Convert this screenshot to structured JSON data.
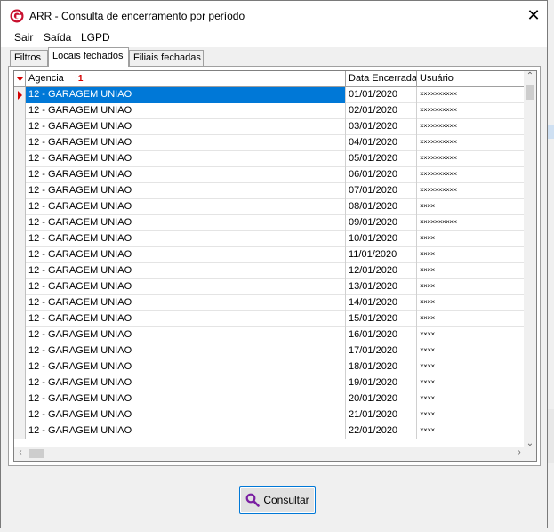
{
  "window": {
    "title": "ARR - Consulta de encerramento por período",
    "close_glyph": "✕"
  },
  "menu": {
    "items": [
      "Sair",
      "Saída",
      "LGPD"
    ]
  },
  "tabs": [
    {
      "label": "Filtros",
      "active": false
    },
    {
      "label": "Locais fechados",
      "active": true
    },
    {
      "label": "Filiais fechadas",
      "active": false
    }
  ],
  "grid": {
    "columns": [
      {
        "label": "Agencia",
        "sort": "1"
      },
      {
        "label": "Data Encerrada"
      },
      {
        "label": "Usuário"
      }
    ],
    "rows": [
      {
        "agencia": "12 - GARAGEM UNIAO",
        "data": "01/01/2020",
        "usuario": "××××××××××"
      },
      {
        "agencia": "12 - GARAGEM UNIAO",
        "data": "02/01/2020",
        "usuario": "××××××××××"
      },
      {
        "agencia": "12 - GARAGEM UNIAO",
        "data": "03/01/2020",
        "usuario": "××××××××××"
      },
      {
        "agencia": "12 - GARAGEM UNIAO",
        "data": "04/01/2020",
        "usuario": "××××××××××"
      },
      {
        "agencia": "12 - GARAGEM UNIAO",
        "data": "05/01/2020",
        "usuario": "××××××××××"
      },
      {
        "agencia": "12 - GARAGEM UNIAO",
        "data": "06/01/2020",
        "usuario": "××××××××××"
      },
      {
        "agencia": "12 - GARAGEM UNIAO",
        "data": "07/01/2020",
        "usuario": "××××××××××"
      },
      {
        "agencia": "12 - GARAGEM UNIAO",
        "data": "08/01/2020",
        "usuario": "××××"
      },
      {
        "agencia": "12 - GARAGEM UNIAO",
        "data": "09/01/2020",
        "usuario": "××××××××××"
      },
      {
        "agencia": "12 - GARAGEM UNIAO",
        "data": "10/01/2020",
        "usuario": "××××"
      },
      {
        "agencia": "12 - GARAGEM UNIAO",
        "data": "11/01/2020",
        "usuario": "××××"
      },
      {
        "agencia": "12 - GARAGEM UNIAO",
        "data": "12/01/2020",
        "usuario": "××××"
      },
      {
        "agencia": "12 - GARAGEM UNIAO",
        "data": "13/01/2020",
        "usuario": "××××"
      },
      {
        "agencia": "12 - GARAGEM UNIAO",
        "data": "14/01/2020",
        "usuario": "××××"
      },
      {
        "agencia": "12 - GARAGEM UNIAO",
        "data": "15/01/2020",
        "usuario": "××××"
      },
      {
        "agencia": "12 - GARAGEM UNIAO",
        "data": "16/01/2020",
        "usuario": "××××"
      },
      {
        "agencia": "12 - GARAGEM UNIAO",
        "data": "17/01/2020",
        "usuario": "××××"
      },
      {
        "agencia": "12 - GARAGEM UNIAO",
        "data": "18/01/2020",
        "usuario": "××××"
      },
      {
        "agencia": "12 - GARAGEM UNIAO",
        "data": "19/01/2020",
        "usuario": "××××"
      },
      {
        "agencia": "12 - GARAGEM UNIAO",
        "data": "20/01/2020",
        "usuario": "××××"
      },
      {
        "agencia": "12 - GARAGEM UNIAO",
        "data": "21/01/2020",
        "usuario": "××××"
      },
      {
        "agencia": "12 - GARAGEM UNIAO",
        "data": "22/01/2020",
        "usuario": "××××"
      }
    ],
    "selected_row": 0
  },
  "consultar_button": {
    "label": "Consultar",
    "icon": "magnifier-icon"
  },
  "colors": {
    "selection": "#0078d7",
    "sort_marker": "#d40000",
    "accent_purple": "#7a1fa2"
  }
}
